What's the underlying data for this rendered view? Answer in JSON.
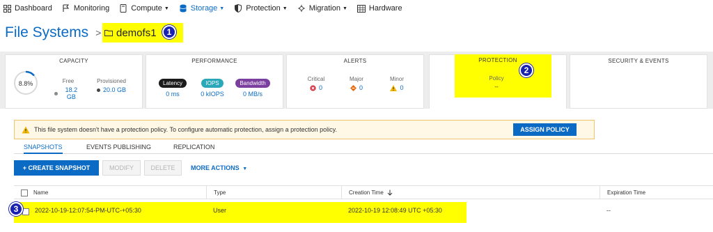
{
  "nav": {
    "items": [
      {
        "label": "Dashboard",
        "icon": "dashboard-icon"
      },
      {
        "label": "Monitoring",
        "icon": "flag-icon"
      },
      {
        "label": "Compute",
        "icon": "compute-icon",
        "has_menu": true
      },
      {
        "label": "Storage",
        "icon": "storage-icon",
        "has_menu": true,
        "active": true
      },
      {
        "label": "Protection",
        "icon": "shield-icon",
        "has_menu": true
      },
      {
        "label": "Migration",
        "icon": "migration-icon",
        "has_menu": true
      },
      {
        "label": "Hardware",
        "icon": "hardware-icon"
      }
    ]
  },
  "header": {
    "title": "File Systems",
    "separator": ">",
    "filesystem_name": "demofs1"
  },
  "callouts": [
    "1",
    "2",
    "3"
  ],
  "cards": {
    "capacity": {
      "title": "CAPACITY",
      "percent": "8.8%",
      "free_label": "Free",
      "free_value": "18.2 GB",
      "provisioned_label": "Provisioned",
      "provisioned_value": "20.0 GB"
    },
    "performance": {
      "title": "PERFORMANCE",
      "latency_label": "Latency",
      "latency_value": "0 ms",
      "iops_label": "IOPS",
      "iops_value": "0 kIOPS",
      "bandwidth_label": "Bandwidth",
      "bandwidth_value": "0 MB/s"
    },
    "alerts": {
      "title": "ALERTS",
      "critical_label": "Critical",
      "critical_value": "0",
      "major_label": "Major",
      "major_value": "0",
      "minor_label": "Minor",
      "minor_value": "0"
    },
    "protection": {
      "title": "PROTECTION",
      "policy_label": "Policy",
      "policy_value": "--"
    },
    "security": {
      "title": "SECURITY & EVENTS"
    }
  },
  "banner": {
    "message": "This file system doesn't have a protection policy. To configure automatic protection, assign a protection policy.",
    "button": "ASSIGN POLICY"
  },
  "tabs": [
    "SNAPSHOTS",
    "EVENTS PUBLISHING",
    "REPLICATION"
  ],
  "actions": {
    "create": "+ CREATE SNAPSHOT",
    "modify": "MODIFY",
    "delete": "DELETE",
    "more": "MORE ACTIONS"
  },
  "table": {
    "columns": [
      "Name",
      "Type",
      "Creation Time",
      "Expiration Time"
    ],
    "rows": [
      {
        "name": "2022-10-19-12:07:54-PM-UTC-+05:30",
        "type": "User",
        "creation_time": "2022-10-19 12:08:49 UTC +05:30",
        "expiration_time": "--"
      }
    ]
  },
  "colors": {
    "accent": "#0b6bc4",
    "highlight": "#ffff00",
    "callout": "#1a23b0",
    "iops_pill": "#2aa7b8",
    "bandwidth_pill": "#7b3fa0",
    "latency_pill": "#1b1b1b",
    "critical": "#d6273b",
    "major": "#e66b12",
    "minor": "#f2b705"
  }
}
